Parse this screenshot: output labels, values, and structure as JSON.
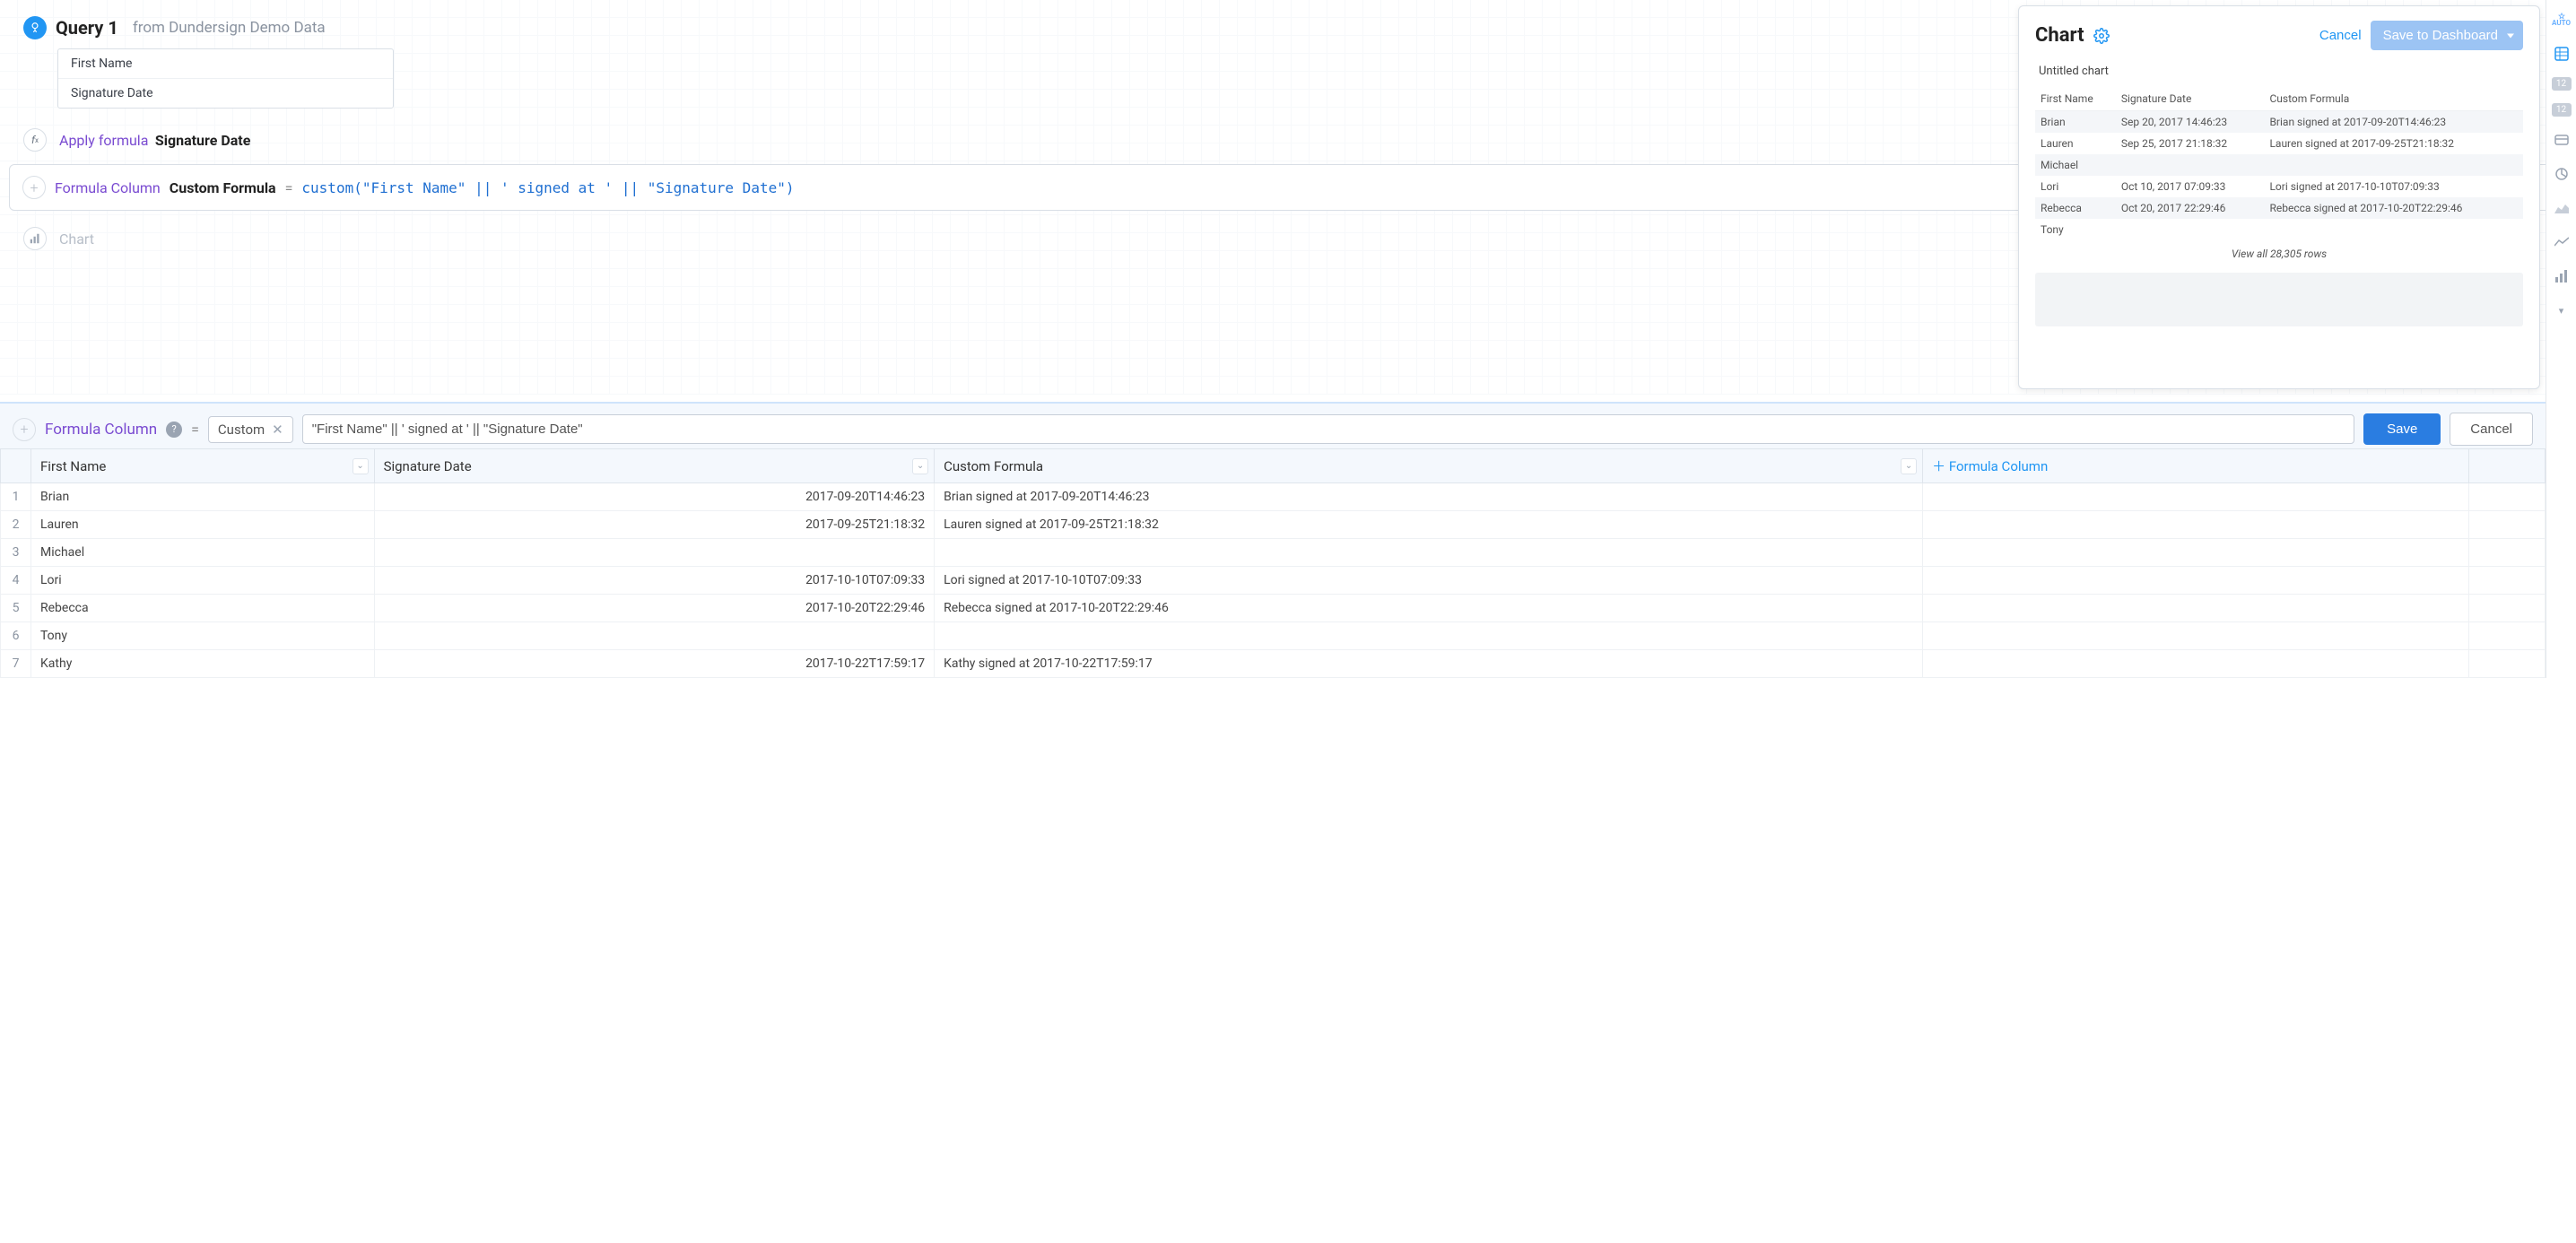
{
  "query": {
    "title": "Query 1",
    "from_prefix": "from",
    "source": "Dundersign Demo Data",
    "fields": [
      "First Name",
      "Signature Date"
    ]
  },
  "apply_step": {
    "label": "Apply formula",
    "target": "Signature Date"
  },
  "formula_card": {
    "title": "Formula Column",
    "name": "Custom Formula",
    "eq": "=",
    "expr": "custom(\"First Name\" || ' signed at ' || \"Signature Date\")"
  },
  "chart_step": {
    "label": "Chart"
  },
  "chart_panel": {
    "title": "Chart",
    "cancel": "Cancel",
    "save": "Save to Dashboard",
    "untitled": "Untitled chart",
    "columns": [
      "First Name",
      "Signature Date",
      "Custom Formula"
    ],
    "rows": [
      {
        "first": "Brian",
        "sig": "Sep 20, 2017 14:46:23",
        "cf": "Brian signed at 2017-09-20T14:46:23"
      },
      {
        "first": "Lauren",
        "sig": "Sep 25, 2017 21:18:32",
        "cf": "Lauren signed at 2017-09-25T21:18:32"
      },
      {
        "first": "Michael",
        "sig": "",
        "cf": ""
      },
      {
        "first": "Lori",
        "sig": "Oct 10, 2017 07:09:33",
        "cf": "Lori signed at 2017-10-10T07:09:33"
      },
      {
        "first": "Rebecca",
        "sig": "Oct 20, 2017 22:29:46",
        "cf": "Rebecca signed at 2017-10-20T22:29:46"
      },
      {
        "first": "Tony",
        "sig": "",
        "cf": ""
      }
    ],
    "view_all": "View all 28,305 rows"
  },
  "editor_bar": {
    "label": "Formula Column",
    "eq": "=",
    "chip": "Custom",
    "input_value": "\"First Name\" || ' signed at ' || \"Signature Date\"",
    "save": "Save",
    "cancel": "Cancel"
  },
  "grid": {
    "columns": [
      "First Name",
      "Signature Date",
      "Custom Formula"
    ],
    "add_col_label": "Formula Column",
    "rows": [
      {
        "n": 1,
        "first": "Brian",
        "sig": "2017-09-20T14:46:23",
        "cf": "Brian signed at 2017-09-20T14:46:23"
      },
      {
        "n": 2,
        "first": "Lauren",
        "sig": "2017-09-25T21:18:32",
        "cf": "Lauren signed at 2017-09-25T21:18:32"
      },
      {
        "n": 3,
        "first": "Michael",
        "sig": "",
        "cf": ""
      },
      {
        "n": 4,
        "first": "Lori",
        "sig": "2017-10-10T07:09:33",
        "cf": "Lori signed at 2017-10-10T07:09:33"
      },
      {
        "n": 5,
        "first": "Rebecca",
        "sig": "2017-10-20T22:29:46",
        "cf": "Rebecca signed at 2017-10-20T22:29:46"
      },
      {
        "n": 6,
        "first": "Tony",
        "sig": "",
        "cf": ""
      },
      {
        "n": 7,
        "first": "Kathy",
        "sig": "2017-10-22T17:59:17",
        "cf": "Kathy signed at 2017-10-22T17:59:17"
      }
    ]
  },
  "rail": {
    "auto": "AUTO",
    "badge1": "12",
    "badge2": "12"
  }
}
